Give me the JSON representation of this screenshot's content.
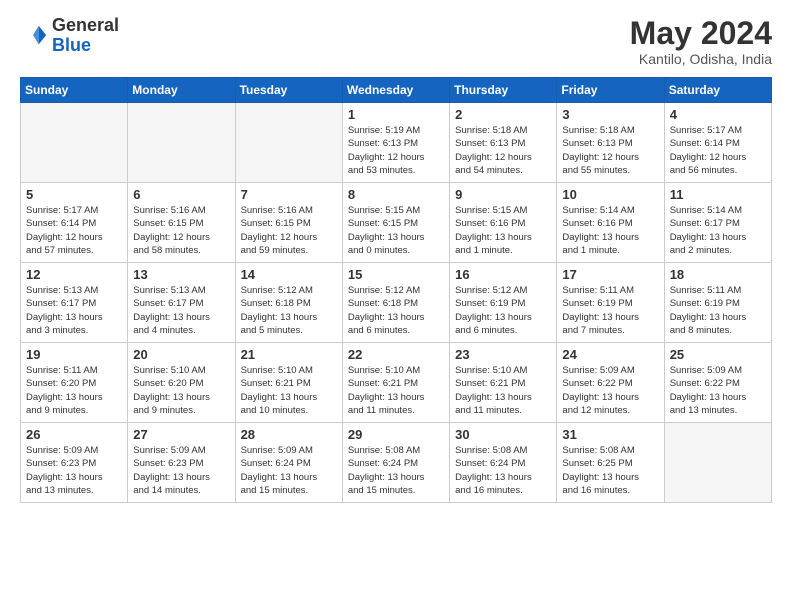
{
  "header": {
    "logo_general": "General",
    "logo_blue": "Blue",
    "month_title": "May 2024",
    "location": "Kantilo, Odisha, India"
  },
  "weekdays": [
    "Sunday",
    "Monday",
    "Tuesday",
    "Wednesday",
    "Thursday",
    "Friday",
    "Saturday"
  ],
  "weeks": [
    [
      {
        "day": "",
        "info": ""
      },
      {
        "day": "",
        "info": ""
      },
      {
        "day": "",
        "info": ""
      },
      {
        "day": "1",
        "info": "Sunrise: 5:19 AM\nSunset: 6:13 PM\nDaylight: 12 hours\nand 53 minutes."
      },
      {
        "day": "2",
        "info": "Sunrise: 5:18 AM\nSunset: 6:13 PM\nDaylight: 12 hours\nand 54 minutes."
      },
      {
        "day": "3",
        "info": "Sunrise: 5:18 AM\nSunset: 6:13 PM\nDaylight: 12 hours\nand 55 minutes."
      },
      {
        "day": "4",
        "info": "Sunrise: 5:17 AM\nSunset: 6:14 PM\nDaylight: 12 hours\nand 56 minutes."
      }
    ],
    [
      {
        "day": "5",
        "info": "Sunrise: 5:17 AM\nSunset: 6:14 PM\nDaylight: 12 hours\nand 57 minutes."
      },
      {
        "day": "6",
        "info": "Sunrise: 5:16 AM\nSunset: 6:15 PM\nDaylight: 12 hours\nand 58 minutes."
      },
      {
        "day": "7",
        "info": "Sunrise: 5:16 AM\nSunset: 6:15 PM\nDaylight: 12 hours\nand 59 minutes."
      },
      {
        "day": "8",
        "info": "Sunrise: 5:15 AM\nSunset: 6:15 PM\nDaylight: 13 hours\nand 0 minutes."
      },
      {
        "day": "9",
        "info": "Sunrise: 5:15 AM\nSunset: 6:16 PM\nDaylight: 13 hours\nand 1 minute."
      },
      {
        "day": "10",
        "info": "Sunrise: 5:14 AM\nSunset: 6:16 PM\nDaylight: 13 hours\nand 1 minute."
      },
      {
        "day": "11",
        "info": "Sunrise: 5:14 AM\nSunset: 6:17 PM\nDaylight: 13 hours\nand 2 minutes."
      }
    ],
    [
      {
        "day": "12",
        "info": "Sunrise: 5:13 AM\nSunset: 6:17 PM\nDaylight: 13 hours\nand 3 minutes."
      },
      {
        "day": "13",
        "info": "Sunrise: 5:13 AM\nSunset: 6:17 PM\nDaylight: 13 hours\nand 4 minutes."
      },
      {
        "day": "14",
        "info": "Sunrise: 5:12 AM\nSunset: 6:18 PM\nDaylight: 13 hours\nand 5 minutes."
      },
      {
        "day": "15",
        "info": "Sunrise: 5:12 AM\nSunset: 6:18 PM\nDaylight: 13 hours\nand 6 minutes."
      },
      {
        "day": "16",
        "info": "Sunrise: 5:12 AM\nSunset: 6:19 PM\nDaylight: 13 hours\nand 6 minutes."
      },
      {
        "day": "17",
        "info": "Sunrise: 5:11 AM\nSunset: 6:19 PM\nDaylight: 13 hours\nand 7 minutes."
      },
      {
        "day": "18",
        "info": "Sunrise: 5:11 AM\nSunset: 6:19 PM\nDaylight: 13 hours\nand 8 minutes."
      }
    ],
    [
      {
        "day": "19",
        "info": "Sunrise: 5:11 AM\nSunset: 6:20 PM\nDaylight: 13 hours\nand 9 minutes."
      },
      {
        "day": "20",
        "info": "Sunrise: 5:10 AM\nSunset: 6:20 PM\nDaylight: 13 hours\nand 9 minutes."
      },
      {
        "day": "21",
        "info": "Sunrise: 5:10 AM\nSunset: 6:21 PM\nDaylight: 13 hours\nand 10 minutes."
      },
      {
        "day": "22",
        "info": "Sunrise: 5:10 AM\nSunset: 6:21 PM\nDaylight: 13 hours\nand 11 minutes."
      },
      {
        "day": "23",
        "info": "Sunrise: 5:10 AM\nSunset: 6:21 PM\nDaylight: 13 hours\nand 11 minutes."
      },
      {
        "day": "24",
        "info": "Sunrise: 5:09 AM\nSunset: 6:22 PM\nDaylight: 13 hours\nand 12 minutes."
      },
      {
        "day": "25",
        "info": "Sunrise: 5:09 AM\nSunset: 6:22 PM\nDaylight: 13 hours\nand 13 minutes."
      }
    ],
    [
      {
        "day": "26",
        "info": "Sunrise: 5:09 AM\nSunset: 6:23 PM\nDaylight: 13 hours\nand 13 minutes."
      },
      {
        "day": "27",
        "info": "Sunrise: 5:09 AM\nSunset: 6:23 PM\nDaylight: 13 hours\nand 14 minutes."
      },
      {
        "day": "28",
        "info": "Sunrise: 5:09 AM\nSunset: 6:24 PM\nDaylight: 13 hours\nand 15 minutes."
      },
      {
        "day": "29",
        "info": "Sunrise: 5:08 AM\nSunset: 6:24 PM\nDaylight: 13 hours\nand 15 minutes."
      },
      {
        "day": "30",
        "info": "Sunrise: 5:08 AM\nSunset: 6:24 PM\nDaylight: 13 hours\nand 16 minutes."
      },
      {
        "day": "31",
        "info": "Sunrise: 5:08 AM\nSunset: 6:25 PM\nDaylight: 13 hours\nand 16 minutes."
      },
      {
        "day": "",
        "info": ""
      }
    ]
  ]
}
